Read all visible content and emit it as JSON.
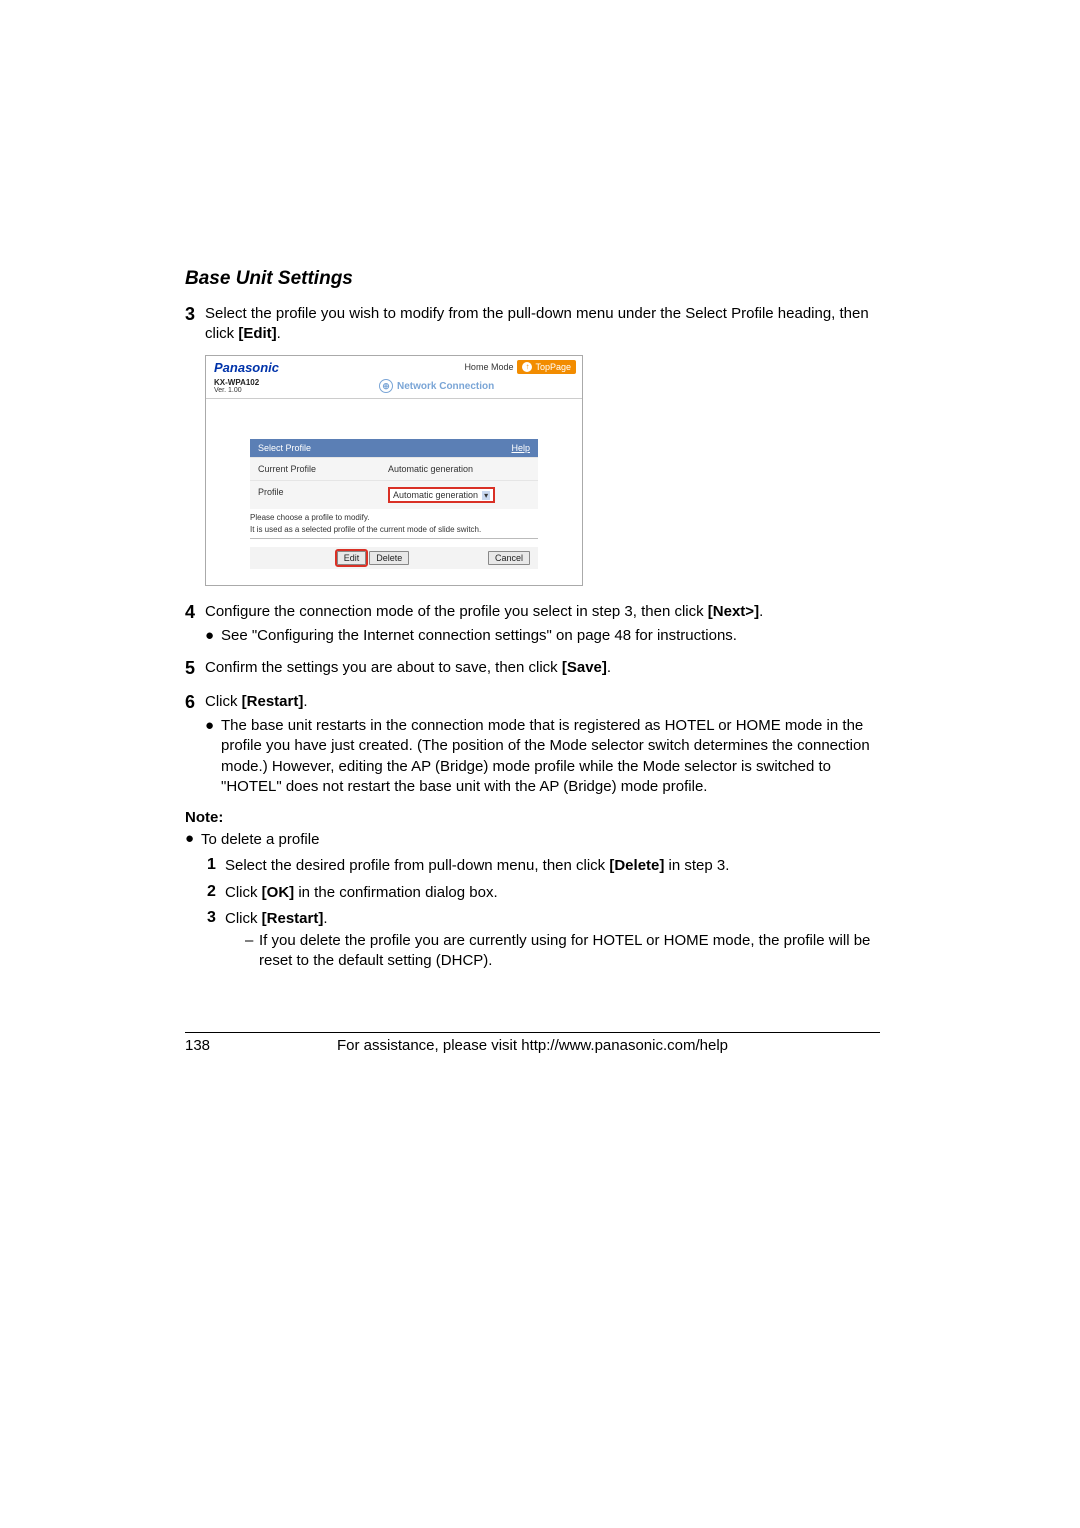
{
  "section_title": "Base Unit Settings",
  "step3": {
    "num": "3",
    "text_a": "Select the profile you wish to modify from the pull-down menu under the Select Profile heading, then click ",
    "bold": "[Edit]",
    "text_b": "."
  },
  "shot": {
    "brand": "Panasonic",
    "home_mode": "Home Mode",
    "toppage": "TopPage",
    "model": "KX-WPA102",
    "ver": "Ver. 1.00",
    "netconn": "Network Connection",
    "select_profile": "Select Profile",
    "help": "Help",
    "current_profile_label": "Current Profile",
    "current_profile_value": "Automatic generation",
    "profile_label": "Profile",
    "profile_select_value": "Automatic generation",
    "instr1": "Please choose a profile to modify.",
    "instr2": "It is used as a selected profile of the current mode of slide switch.",
    "edit_btn": "Edit",
    "delete_btn": "Delete",
    "cancel_btn": "Cancel"
  },
  "step4": {
    "num": "4",
    "text_a": "Configure the connection mode of the profile you select in step 3, then click ",
    "bold": "[Next>]",
    "text_b": ".",
    "bullet": "See \"Configuring the Internet connection settings\" on page 48 for instructions."
  },
  "step5": {
    "num": "5",
    "text_a": "Confirm the settings you are about to save, then click ",
    "bold": "[Save]",
    "text_b": "."
  },
  "step6": {
    "num": "6",
    "text_a": "Click ",
    "bold": "[Restart]",
    "text_b": ".",
    "bullet": "The base unit restarts in the connection mode that is registered as HOTEL or HOME mode in the profile you have just created. (The position of the Mode selector switch determines the connection mode.) However, editing the AP (Bridge) mode profile while the Mode selector is switched to \"HOTEL\" does not restart the base unit with the AP (Bridge) mode profile."
  },
  "note_label": "Note:",
  "note_bullet": "To delete a profile",
  "sub1": {
    "num": "1",
    "text_a": "Select the desired profile from pull-down menu, then click ",
    "bold": "[Delete]",
    "text_b": " in step 3."
  },
  "sub2": {
    "num": "2",
    "text_a": "Click ",
    "bold": "[OK]",
    "text_b": " in the confirmation dialog box."
  },
  "sub3": {
    "num": "3",
    "text_a": "Click ",
    "bold": "[Restart]",
    "text_b": ".",
    "dash": "If you delete the profile you are currently using for HOTEL or HOME mode, the profile will be reset to the default setting (DHCP)."
  },
  "footer": {
    "page": "138",
    "text": "For assistance, please visit http://www.panasonic.com/help"
  }
}
